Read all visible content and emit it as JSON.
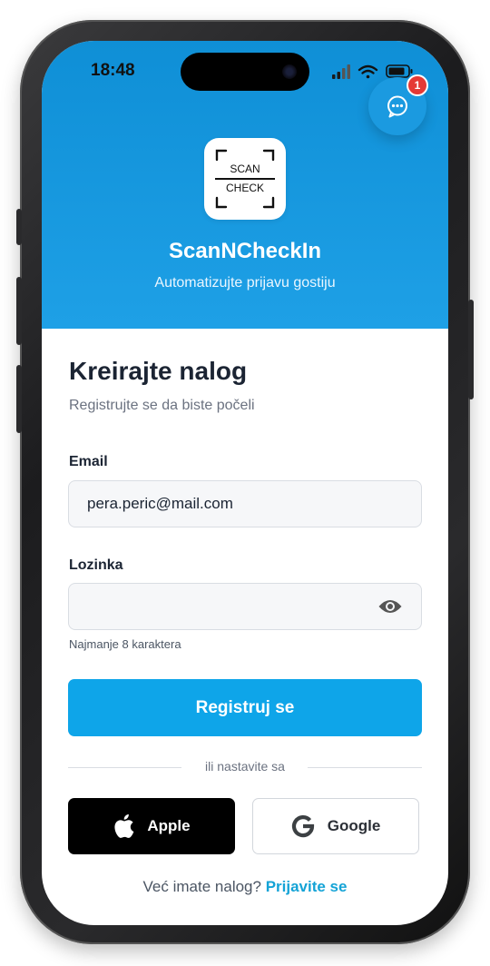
{
  "status_bar": {
    "time": "18:48"
  },
  "chat": {
    "badge_count": "1",
    "icon": "chat-bubble-icon"
  },
  "header": {
    "logo_top": "SCAN",
    "logo_bottom": "CHECK",
    "app_name": "ScanNCheckIn",
    "tagline": "Automatizujte prijavu gostiju"
  },
  "form": {
    "title": "Kreirajte nalog",
    "subtitle": "Registrujte se da biste počeli",
    "email_label": "Email",
    "email_value": "pera.peric@mail.com",
    "password_label": "Lozinka",
    "password_value": "",
    "password_hint": "Najmanje 8 karaktera",
    "submit_label": "Registruj se",
    "divider_text": "ili nastavite sa",
    "apple_label": "Apple",
    "google_label": "Google",
    "footer_text": "Već imate nalog?",
    "footer_link": "Prijavite se"
  },
  "colors": {
    "header": "#1ea0e6",
    "primary": "#0ea5e9",
    "link": "#14a3d6",
    "badge": "#e53935"
  }
}
